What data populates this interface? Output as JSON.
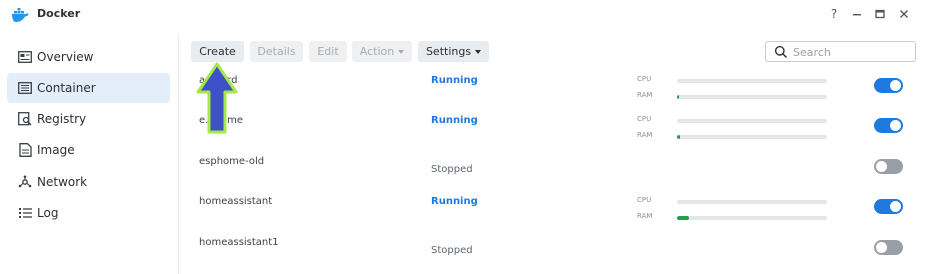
{
  "window": {
    "title": "Docker",
    "help_icon": "?",
    "minimize_icon": "minimize-icon",
    "maximize_icon": "maximize-icon",
    "close_icon": "close-icon"
  },
  "sidebar": {
    "items": [
      {
        "label": "Overview",
        "icon": "overview-icon",
        "active": false
      },
      {
        "label": "Container",
        "icon": "container-icon",
        "active": true
      },
      {
        "label": "Registry",
        "icon": "registry-icon",
        "active": false
      },
      {
        "label": "Image",
        "icon": "image-icon",
        "active": false
      },
      {
        "label": "Network",
        "icon": "network-icon",
        "active": false
      },
      {
        "label": "Log",
        "icon": "log-icon",
        "active": false
      }
    ]
  },
  "toolbar": {
    "create": "Create",
    "details": "Details",
    "edit": "Edit",
    "action": "Action",
    "settings": "Settings",
    "search_placeholder": "Search"
  },
  "containers": [
    {
      "name": "ad...ard",
      "image": "",
      "status": "Running",
      "uptime": "",
      "cpu_label": "CPU",
      "ram_label": "RAM",
      "cpu_pct": 0,
      "ram_pct": 1,
      "enabled": true
    },
    {
      "name": "e...home",
      "image": "",
      "status": "Running",
      "uptime": "",
      "cpu_label": "CPU",
      "ram_label": "RAM",
      "cpu_pct": 0,
      "ram_pct": 2,
      "enabled": true
    },
    {
      "name": "esphome-old",
      "image": "",
      "status": "Stopped",
      "uptime": "",
      "cpu_label": "",
      "ram_label": "",
      "cpu_pct": null,
      "ram_pct": null,
      "enabled": false
    },
    {
      "name": "homeassistant",
      "image": "",
      "status": "Running",
      "uptime": "",
      "cpu_label": "CPU",
      "ram_label": "RAM",
      "cpu_pct": 0,
      "ram_pct": 8,
      "enabled": true
    },
    {
      "name": "homeassistant1",
      "image": "",
      "status": "Stopped",
      "uptime": "",
      "cpu_label": "",
      "ram_label": "",
      "cpu_pct": null,
      "ram_pct": null,
      "enabled": false
    }
  ],
  "colors": {
    "accent": "#1f7ae0",
    "running": "#1f7ae0",
    "ram_fill": "#1fa24a",
    "arrow_fill": "#3f51c7",
    "arrow_outline": "#a4e84a"
  }
}
